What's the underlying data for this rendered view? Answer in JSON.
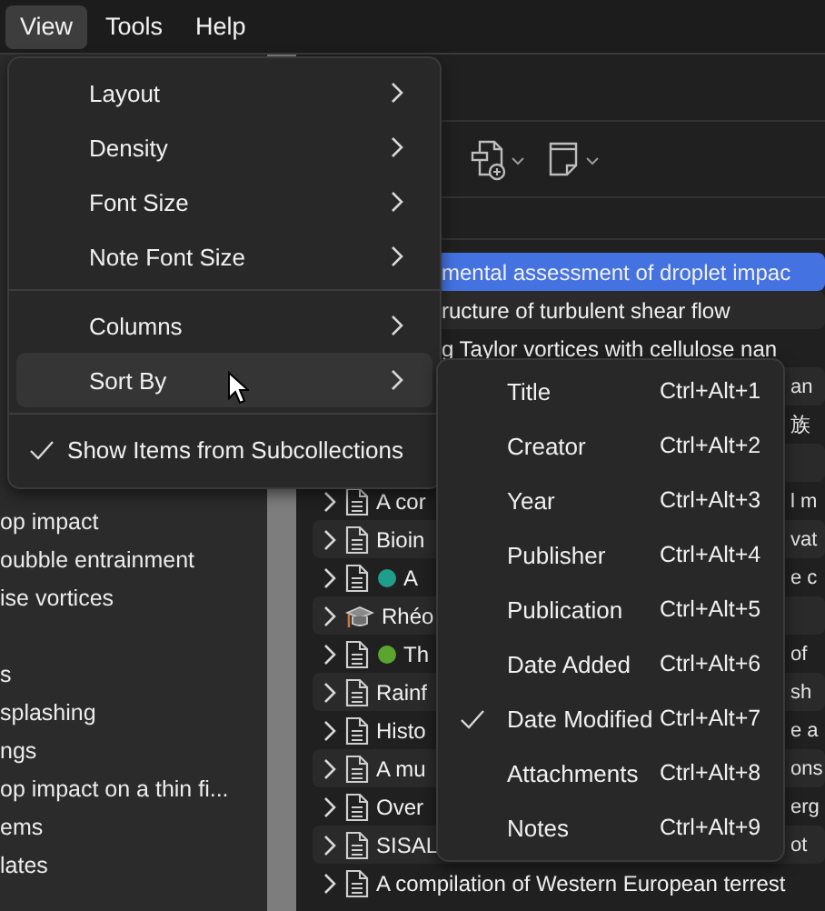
{
  "menubar": [
    {
      "label": "View",
      "selected": true
    },
    {
      "label": "Tools",
      "selected": false
    },
    {
      "label": "Help",
      "selected": false
    }
  ],
  "toolbar": [
    {
      "kind": "new-attachment"
    },
    {
      "kind": "new-note"
    }
  ],
  "collections": [
    [
      "op impact",
      "oubble entrainment",
      "ise vortices"
    ],
    [
      "s",
      "splashing",
      "ngs",
      "op impact on a thin fi...",
      "ems",
      "lates"
    ]
  ],
  "items": [
    {
      "title": "mental assessment of droplet impac",
      "selected": true
    },
    {
      "title": "ructure of turbulent shear flow",
      "selected": false
    },
    {
      "title": "g Taylor vortices with cellulose nan",
      "selected": false
    },
    {
      "column_2": "an",
      "selected": false
    },
    {
      "column_2": "族",
      "selected": false
    },
    {
      "selected": false
    },
    {
      "kind": "document",
      "title": "A cor",
      "column_2": "l m",
      "selected": false
    },
    {
      "kind": "document",
      "title": "Bioin",
      "column_2": "vat",
      "selected": false
    },
    {
      "kind": "document",
      "color": "#1f9e8c",
      "title": "A",
      "column_2": "e c",
      "selected": false
    },
    {
      "kind": "thesis",
      "title": "Rhéo",
      "selected": false
    },
    {
      "kind": "document",
      "color": "#5ba52f",
      "title": "Th",
      "column_2": "of",
      "selected": false
    },
    {
      "kind": "document",
      "title": "Rainf",
      "column_2": "sh",
      "selected": false
    },
    {
      "kind": "document",
      "title": "Histo",
      "column_2": "e a",
      "selected": false
    },
    {
      "kind": "document",
      "title": "A mu",
      "column_2": "ons",
      "selected": false
    },
    {
      "kind": "document",
      "title": "Over",
      "column_2": "erg",
      "selected": false
    },
    {
      "kind": "document",
      "title": "SISAL",
      "column_2": "ot",
      "selected": false
    },
    {
      "kind": "document",
      "title": "A compilation of Western European terrest",
      "selected": false
    }
  ],
  "view_menu": [
    {
      "kind": "submenu",
      "label": "Layout",
      "selected": false
    },
    {
      "kind": "submenu",
      "label": "Density",
      "selected": false
    },
    {
      "kind": "submenu",
      "label": "Font Size",
      "selected": false
    },
    {
      "kind": "submenu",
      "label": "Note Font Size",
      "selected": false
    },
    {
      "kind": "separator"
    },
    {
      "kind": "submenu",
      "label": "Columns",
      "selected": false
    },
    {
      "kind": "submenu",
      "label": "Sort By",
      "selected": true
    },
    {
      "kind": "separator"
    },
    {
      "kind": "check",
      "label": "Show Items from Subcollections",
      "checked": true
    }
  ],
  "sort_menu": [
    {
      "label": "Title",
      "shortcut": "Ctrl+Alt+1",
      "checked": false
    },
    {
      "label": "Creator",
      "shortcut": "Ctrl+Alt+2",
      "checked": false
    },
    {
      "label": "Year",
      "shortcut": "Ctrl+Alt+3",
      "checked": false
    },
    {
      "label": "Publisher",
      "shortcut": "Ctrl+Alt+4",
      "checked": false
    },
    {
      "label": "Publication",
      "shortcut": "Ctrl+Alt+5",
      "checked": false
    },
    {
      "label": "Date Added",
      "shortcut": "Ctrl+Alt+6",
      "checked": false
    },
    {
      "label": "Date Modified",
      "shortcut": "Ctrl+Alt+7",
      "checked": true
    },
    {
      "label": "Attachments",
      "shortcut": "Ctrl+Alt+8",
      "checked": false
    },
    {
      "label": "Notes",
      "shortcut": "Ctrl+Alt+9",
      "checked": false
    }
  ]
}
